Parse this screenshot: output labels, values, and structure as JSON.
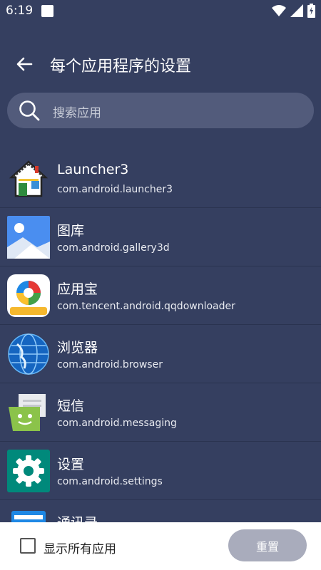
{
  "status_bar": {
    "time": "6:19"
  },
  "header": {
    "title": "每个应用程序的设置"
  },
  "search": {
    "placeholder": "搜索应用"
  },
  "apps": [
    {
      "name": "Launcher3",
      "package": "com.android.launcher3",
      "icon": "launcher-house-icon"
    },
    {
      "name": "图库",
      "package": "com.android.gallery3d",
      "icon": "gallery-icon"
    },
    {
      "name": "应用宝",
      "package": "com.tencent.android.qqdownloader",
      "icon": "app-store-icon"
    },
    {
      "name": "浏览器",
      "package": "com.android.browser",
      "icon": "browser-globe-icon"
    },
    {
      "name": "短信",
      "package": "com.android.messaging",
      "icon": "messaging-icon"
    },
    {
      "name": "设置",
      "package": "com.android.settings",
      "icon": "settings-gear-icon"
    },
    {
      "name": "通讯录",
      "package": "",
      "icon": "contacts-icon"
    }
  ],
  "footer": {
    "show_all_label": "显示所有应用",
    "reset_label": "重置"
  },
  "colors": {
    "background": "#353f60",
    "search_bg": "#525b7b",
    "button_disabled": "#a9acbc"
  }
}
